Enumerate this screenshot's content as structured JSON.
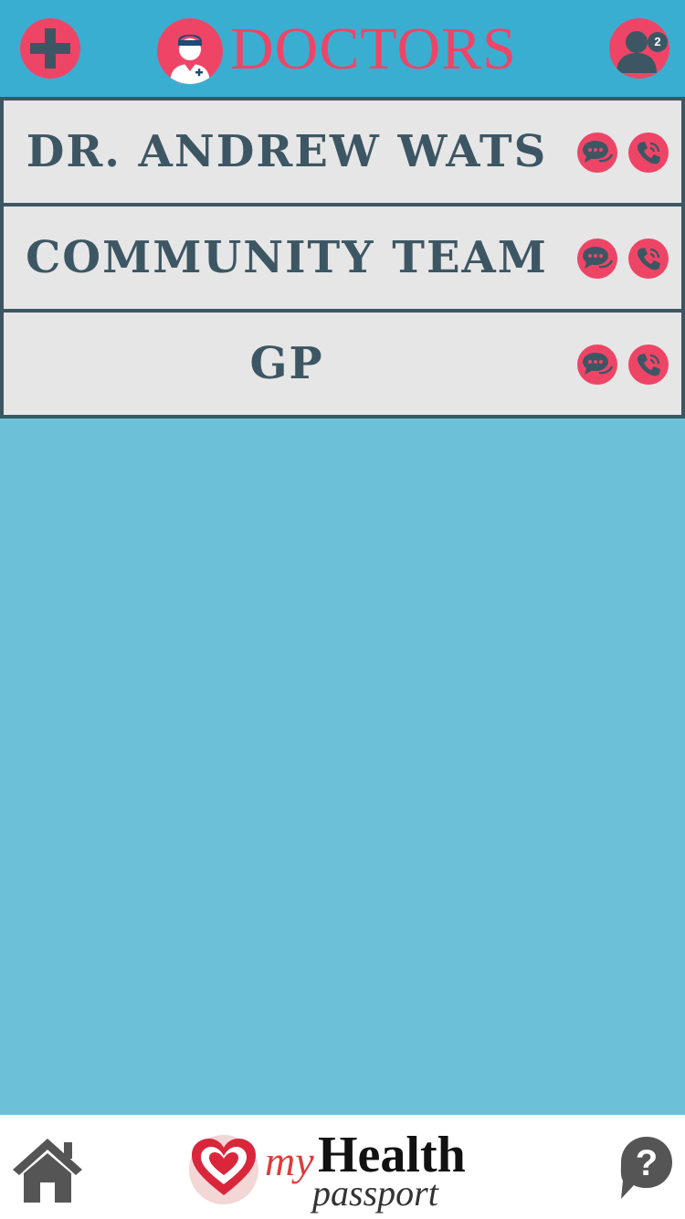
{
  "header": {
    "title": "DOCTORS",
    "notification_count": "2",
    "icons": [
      "plus-icon",
      "doctor-icon",
      "profile-icon"
    ]
  },
  "contacts": [
    {
      "name": "DR. ANDREW WATS",
      "icons": [
        "chat-icon",
        "phone-icon"
      ]
    },
    {
      "name": "COMMUNITY TEAM",
      "icons": [
        "chat-icon",
        "phone-icon"
      ]
    },
    {
      "name": "GP",
      "icons": [
        "chat-icon",
        "phone-icon"
      ]
    }
  ],
  "footer": {
    "logo": {
      "my": "my",
      "health": "Health",
      "passport": "passport"
    },
    "icons": [
      "home-icon",
      "help-icon"
    ]
  },
  "colors": {
    "header_bg": "#3aaed0",
    "accent": "#ee4567",
    "dark": "#3d5663",
    "row_bg": "#e6e6e6",
    "page_bg": "#6cc0d7"
  }
}
